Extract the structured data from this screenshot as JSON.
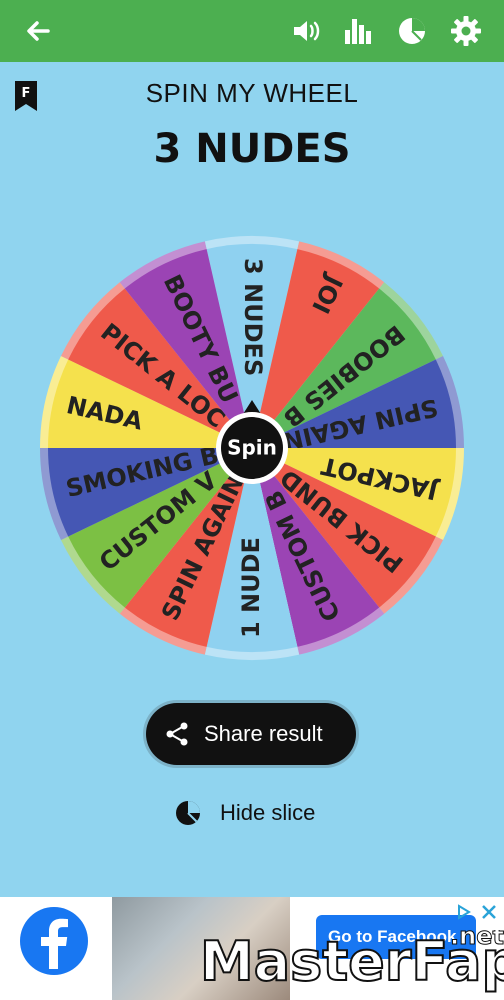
{
  "top_bar": {
    "back_icon": "arrow-left-icon",
    "sound_icon": "volume-icon",
    "stats_icon": "bar-chart-icon",
    "pie_icon": "pie-chart-icon",
    "settings_icon": "gear-icon",
    "bg_color": "#4caf50"
  },
  "header": {
    "badge_letter": "F",
    "app_title": "SPIN MY WHEEL",
    "result": "3 NUDES"
  },
  "wheel": {
    "center_label": "Spin",
    "slices": [
      {
        "label": "3 NUDES",
        "color": "#8fd1f0"
      },
      {
        "label": "JOI",
        "color": "#ef5a4b"
      },
      {
        "label": "BOOBIES B",
        "color": "#5cb85c"
      },
      {
        "label": "SPIN AGAIN",
        "color": "#4557b4"
      },
      {
        "label": "JACKPOT",
        "color": "#f5e14d"
      },
      {
        "label": "PICK BUND",
        "color": "#ef5a4b"
      },
      {
        "label": "CUSTOM B",
        "color": "#9b44b4"
      },
      {
        "label": "1 NUDE",
        "color": "#8fd1f0"
      },
      {
        "label": "SPIN AGAIN",
        "color": "#ef5a4b"
      },
      {
        "label": "CUSTOM V",
        "color": "#7cc044"
      },
      {
        "label": "SMOKING B",
        "color": "#4557b4"
      },
      {
        "label": "NADA",
        "color": "#f5e14d"
      },
      {
        "label": "PICK A LOC",
        "color": "#ef5a4b"
      },
      {
        "label": "BOOTY BU",
        "color": "#9b44b4"
      }
    ]
  },
  "actions": {
    "share_label": "Share result",
    "share_icon": "share-icon",
    "hide_label": "Hide slice",
    "hide_icon": "pie-chart-icon"
  },
  "ad": {
    "logo_icon": "facebook-logo-icon",
    "cta_label": "Go to Facebook",
    "choices_icon": "ad-choices-icon"
  },
  "watermark": {
    "text": "MasterFap",
    "suffix": ".net"
  }
}
